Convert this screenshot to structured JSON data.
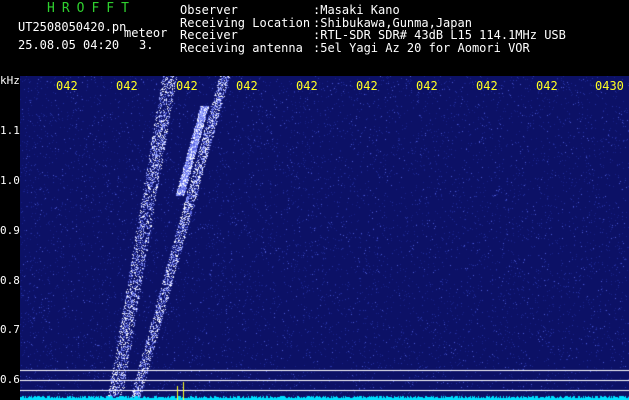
{
  "header": {
    "app_title": "HROFFT",
    "filename": "UT2508050420.pn",
    "meteor_type": "meteor",
    "datetime": "25.08.05 04:20",
    "count": "3."
  },
  "info": [
    {
      "key": "Observer",
      "value": ":Masaki Kano"
    },
    {
      "key": "Receiving Location",
      "value": ":Shibukawa,Gunma,Japan"
    },
    {
      "key": "Receiver",
      "value": ":RTL-SDR SDR# 43dB L15 114.1MHz USB"
    },
    {
      "key": "Receiving antenna",
      "value": ":5el Yagi Az 20 for Aomori VOR"
    }
  ],
  "y_axis": {
    "unit": "kHz",
    "ticks": [
      "1.1",
      "1.0",
      "0.9",
      "0.8",
      "0.7",
      "0.6"
    ]
  },
  "x_axis": {
    "ticks": [
      "042",
      "042",
      "042",
      "042",
      "042",
      "042",
      "042",
      "042",
      "042",
      "0430"
    ]
  },
  "colors": {
    "background": "#0c1166",
    "signal": "#ffffff",
    "trace": "#00e0ff",
    "time_labels": "#ffff20",
    "title": "#2fd12f"
  }
}
